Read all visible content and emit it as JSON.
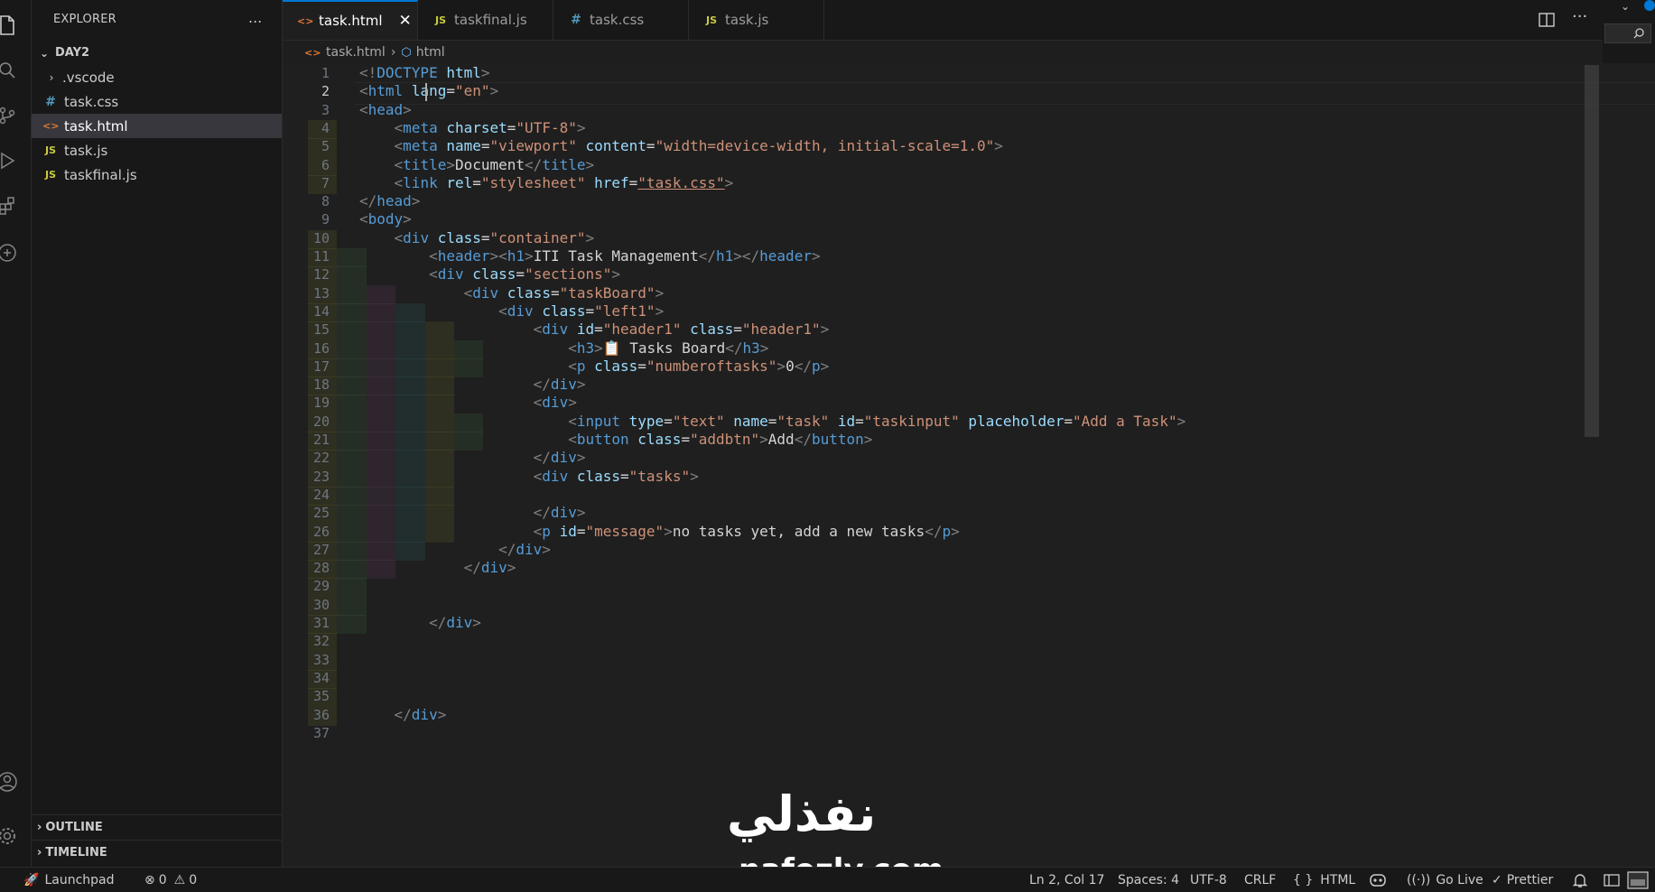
{
  "sidebar": {
    "title": "EXPLORER",
    "more": "...",
    "folder": "DAY2",
    "items": [
      {
        "name": ".vscode",
        "type": "folder"
      },
      {
        "name": "task.css",
        "icon": "#"
      },
      {
        "name": "task.html",
        "icon": "<>",
        "selected": true
      },
      {
        "name": "task.js",
        "icon": "JS"
      },
      {
        "name": "taskfinal.js",
        "icon": "JS"
      }
    ],
    "outline": "OUTLINE",
    "timeline": "TIMELINE"
  },
  "tabs": [
    {
      "label": "task.html",
      "icon": "<>",
      "active": true
    },
    {
      "label": "taskfinal.js",
      "icon": "JS"
    },
    {
      "label": "task.css",
      "icon": "#"
    },
    {
      "label": "task.js",
      "icon": "JS"
    }
  ],
  "breadcrumb": {
    "file": "task.html",
    "symbol": "html"
  },
  "editor": {
    "current_line": 2,
    "line_numbers": [
      "1",
      "2",
      "3",
      "4",
      "5",
      "6",
      "7",
      "8",
      "9",
      "10",
      "11",
      "12",
      "13",
      "14",
      "15",
      "16",
      "17",
      "18",
      "19",
      "20",
      "21",
      "22",
      "23",
      "24",
      "25",
      "26",
      "27",
      "28",
      "29",
      "30",
      "31",
      "32",
      "33",
      "34",
      "35",
      "36",
      "37"
    ],
    "lines": [
      "<!DOCTYPE html>",
      "<html lang=\"en\">",
      "<head>",
      "    <meta charset=\"UTF-8\">",
      "    <meta name=\"viewport\" content=\"width=device-width, initial-scale=1.0\">",
      "    <title>Document</title>",
      "    <link rel=\"stylesheet\" href=\"task.css\">",
      "</head>",
      "<body>",
      "    <div class=\"container\">",
      "        <header><h1>ITI Task Management</h1></header>",
      "        <div class=\"sections\">",
      "            <div class=\"taskBoard\">",
      "                <div class=\"left1\">",
      "                    <div id=\"header1\" class=\"header1\">",
      "                        <h3>📋 Tasks Board</h3>",
      "                        <p class=\"numberoftasks\">0</p>",
      "                    </div>",
      "                    <div>",
      "                        <input type=\"text\" name=\"task\" id=\"taskinput\" placeholder=\"Add a Task\">",
      "                        <button class=\"addbtn\">Add</button>",
      "                    </div>",
      "                    <div class=\"tasks\">",
      "",
      "                    </div>",
      "                    <p id=\"message\">no tasks yet, add a new tasks</p>",
      "                </div>",
      "            </div>",
      "",
      "",
      "        </div>",
      "",
      "",
      "",
      "",
      "    </div>",
      ""
    ]
  },
  "status": {
    "launchpad": "Launchpad",
    "errors": "0",
    "warnings": "0",
    "position": "Ln 2, Col 17",
    "spaces": "Spaces: 4",
    "encoding": "UTF-8",
    "eol": "CRLF",
    "language": "HTML",
    "golive": "Go Live",
    "prettier": "Prettier"
  },
  "watermark": {
    "arabic": "نفذلي",
    "latin": "nafezly.com"
  },
  "colors": {
    "accent": "#0078d4",
    "tag": "#569cd6",
    "attr": "#9cdcfe",
    "string": "#ce9178"
  },
  "icons": [
    "files-icon",
    "search-icon",
    "source-control-icon",
    "run-debug-icon",
    "extensions-icon",
    "remote-icon",
    "account-icon",
    "settings-icon",
    "split-editor-icon",
    "more-icon",
    "bell-icon",
    "copilot-icon"
  ]
}
